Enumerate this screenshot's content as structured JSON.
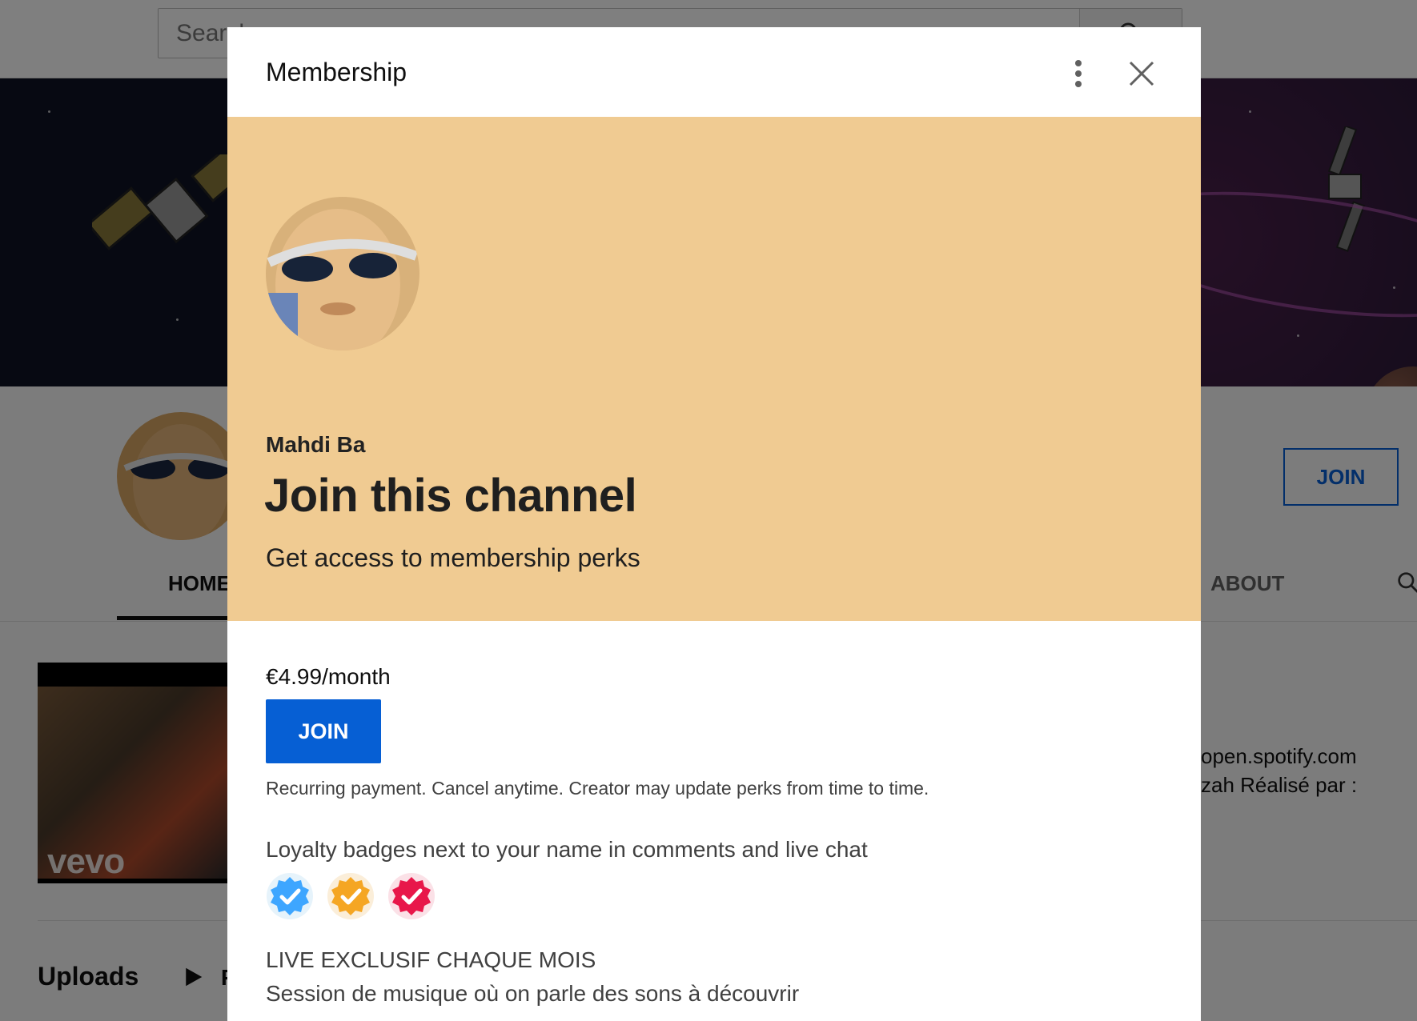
{
  "background": {
    "search_placeholder": "Search",
    "join_label": "JOIN",
    "tabs": {
      "home": "HOME",
      "about": "ABOUT"
    },
    "video_watermark": "vevo",
    "description": {
      "line1": "open.spotify.com",
      "line2": "zah Réalisé par :"
    },
    "uploads_label": "Uploads",
    "uploads_play_text": "P"
  },
  "dialog": {
    "title": "Membership",
    "hero": {
      "channel_name": "Mahdi Ba",
      "heading": "Join this channel",
      "subheading": "Get access to membership perks",
      "background_color": "#f0cb92"
    },
    "price": "€4.99/month",
    "join_label": "JOIN",
    "recurring_note": "Recurring payment. Cancel anytime. Creator may update perks from time to time.",
    "perks": [
      {
        "title": "Loyalty badges next to your name in comments and live chat"
      },
      {
        "title": "LIVE EXCLUSIF CHAQUE MOIS",
        "description": "Session de musique où on parle des sons à découvrir"
      }
    ],
    "badges": [
      {
        "icon": "badge-blue-check-icon",
        "color": "#3ea6ff"
      },
      {
        "icon": "badge-orange-check-icon",
        "color": "#f5a623"
      },
      {
        "icon": "badge-red-check-icon",
        "color": "#e8174a"
      }
    ]
  },
  "colors": {
    "accent": "#065fd4"
  }
}
